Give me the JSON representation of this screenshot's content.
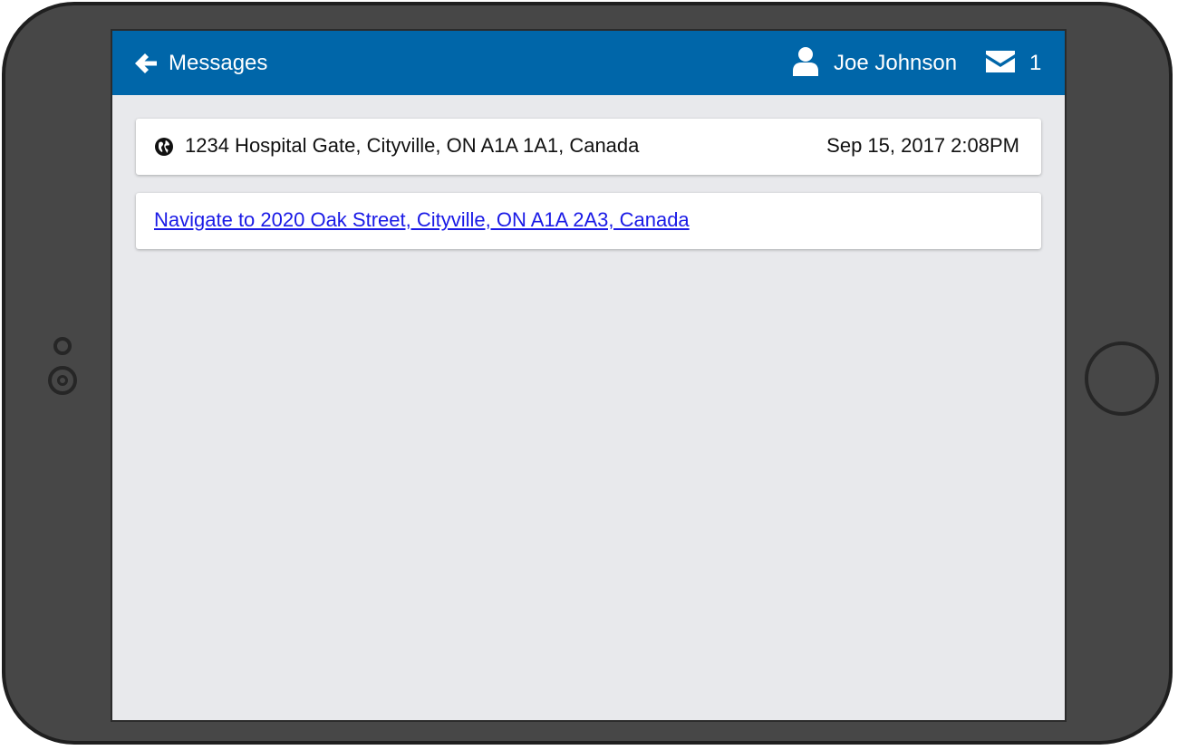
{
  "header": {
    "back_label": "Messages",
    "user_name": "Joe Johnson",
    "message_count": "1"
  },
  "location": {
    "address": "1234 Hospital Gate, Cityville, ON A1A 1A1, Canada",
    "timestamp": "Sep 15, 2017 2:08PM"
  },
  "navigation": {
    "link_text": "Navigate to 2020 Oak Street, Cityville, ON A1A 2A3, Canada"
  },
  "icons": {
    "back": "arrow-left-icon",
    "user": "user-icon",
    "mail": "envelope-icon",
    "location": "globe-icon"
  },
  "colors": {
    "header_bg": "#0066a9",
    "screen_bg": "#e8e9ec",
    "link": "#1a1ae6",
    "device_body": "#474747"
  }
}
